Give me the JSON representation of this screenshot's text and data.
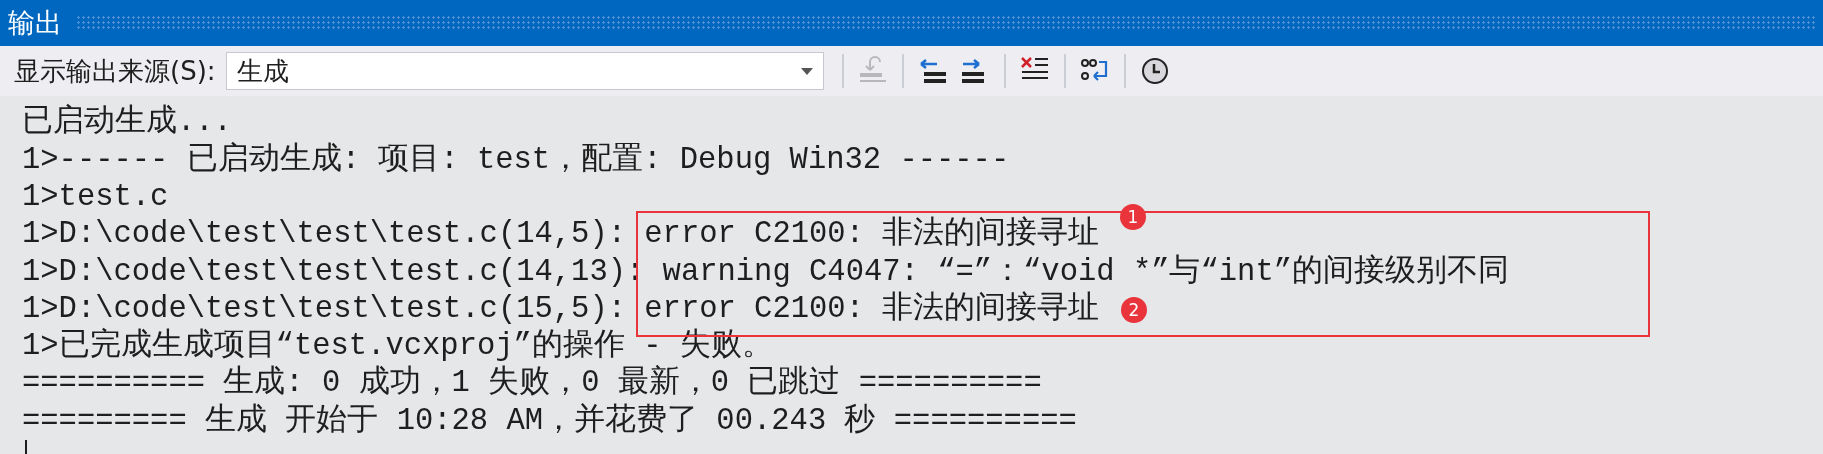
{
  "window": {
    "title": "输出"
  },
  "toolbar": {
    "source_label": "显示输出来源(S):",
    "source_value": "生成",
    "buttons": [
      {
        "kind": "goto",
        "disabled": true
      },
      {
        "kind": "prev",
        "disabled": false
      },
      {
        "kind": "next",
        "disabled": false
      },
      {
        "kind": "clear",
        "disabled": false
      },
      {
        "kind": "wrap",
        "disabled": false
      },
      {
        "kind": "clock",
        "disabled": false
      }
    ]
  },
  "output_lines": [
    "已启动生成...",
    "1>------ 已启动生成: 项目: test，配置: Debug Win32 ------",
    "1>test.c",
    "1>D:\\code\\test\\test\\test.c(14,5): error C2100: 非法的间接寻址",
    "1>D:\\code\\test\\test\\test.c(14,13): warning C4047: “=”：“void *”与“int”的间接级别不同",
    "1>D:\\code\\test\\test\\test.c(15,5): error C2100: 非法的间接寻址",
    "1>已完成生成项目“test.vcxproj”的操作 - 失败。",
    "========== 生成: 0 成功，1 失败，0 最新，0 已跳过 ==========",
    "========= 生成 开始于 10:28 AM，并花费了 00.243 秒 =========="
  ],
  "annotation": {
    "badges": [
      "1",
      "2"
    ]
  }
}
